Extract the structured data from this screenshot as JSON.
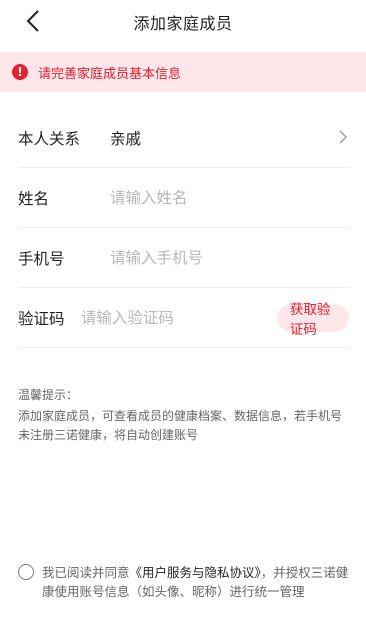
{
  "nav": {
    "title": "添加家庭成员"
  },
  "alert": {
    "text": "请完善家庭成员基本信息"
  },
  "form": {
    "relation": {
      "label": "本人关系",
      "value": "亲戚"
    },
    "name": {
      "label": "姓名",
      "placeholder": "请输入姓名",
      "value": ""
    },
    "phone": {
      "label": "手机号",
      "placeholder": "请输入手机号",
      "value": ""
    },
    "code": {
      "label": "验证码",
      "placeholder": "请输入验证码",
      "value": "",
      "button_label": "获取验证码"
    }
  },
  "tips": {
    "title": "温馨提示：",
    "body": "添加家庭成员，可查看成员的健康档案、数据信息，若手机号未注册三诺健康，将自动创建账号"
  },
  "agreement": {
    "prefix": "我已阅读并同意",
    "link": "《用户服务与隐私协议》",
    "suffix": "，并授权三诺健康使用账号信息（如头像、昵称）进行统一管理",
    "checked": false
  },
  "colors": {
    "accent": "#e8202f",
    "alert_bg": "#fde7ea"
  }
}
